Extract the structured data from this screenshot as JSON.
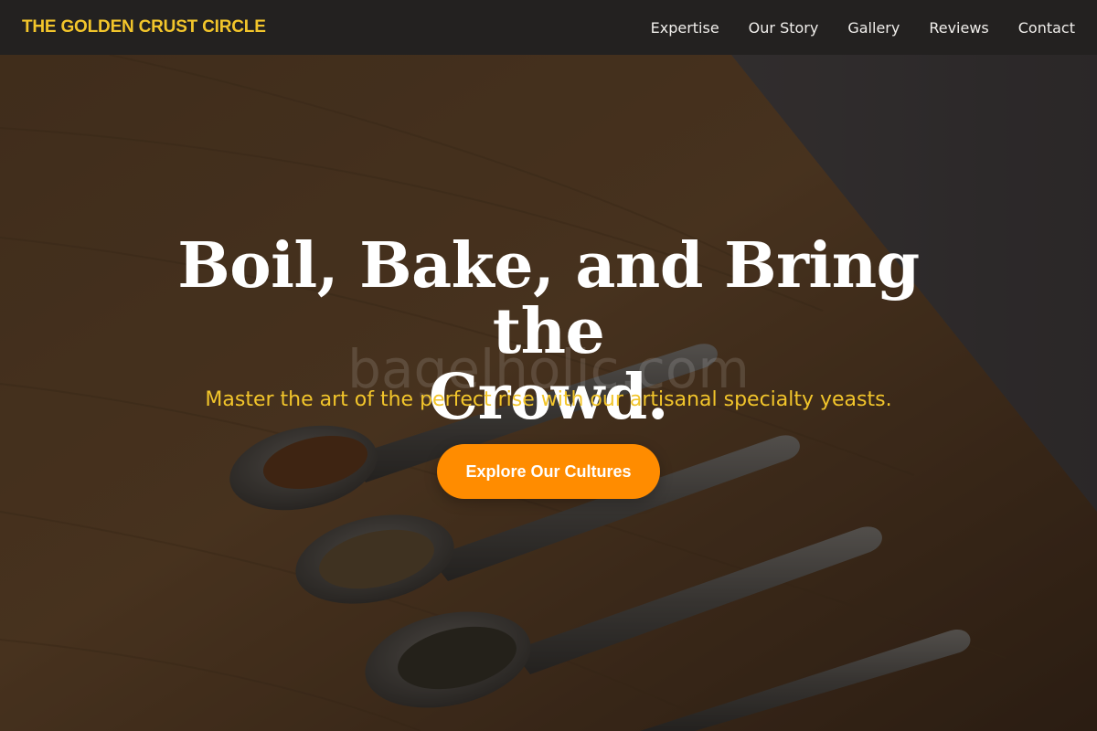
{
  "brand": {
    "name": "THE GOLDEN CRUST CIRCLE"
  },
  "nav": {
    "items": [
      {
        "label": "Expertise"
      },
      {
        "label": "Our Story"
      },
      {
        "label": "Gallery"
      },
      {
        "label": "Reviews"
      },
      {
        "label": "Contact"
      }
    ]
  },
  "hero": {
    "title_line1": "Boil, Bake, and Bring the",
    "title_line2": "Crowd.",
    "watermark": "bagelholic.com",
    "subtitle": "Master the art of the perfect rise with our artisanal specialty yeasts.",
    "cta_label": "Explore Our Cultures",
    "background_image": "spoons-of-yeast-on-wooden-table"
  },
  "colors": {
    "nav_background": "#232120",
    "brand_accent": "#f2c52b",
    "cta_background": "#ff8c00",
    "title_text": "#ffffff"
  }
}
